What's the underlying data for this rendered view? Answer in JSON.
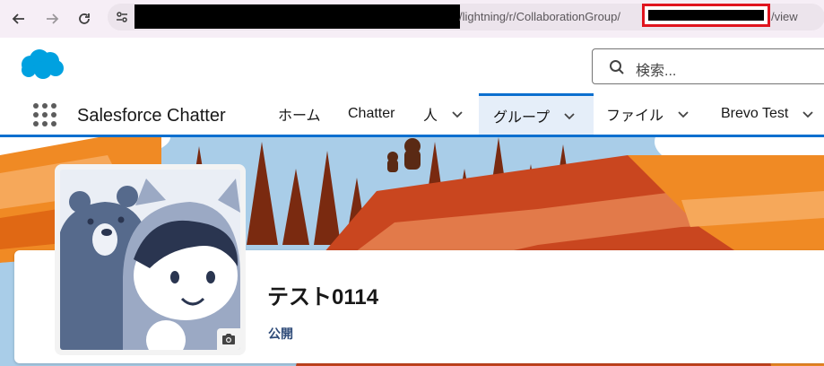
{
  "browser": {
    "url_path": "/lightning/r/CollaborationGroup/",
    "url_tail": "/view"
  },
  "header": {
    "search_placeholder": "検索..."
  },
  "app": {
    "name": "Salesforce Chatter",
    "tabs": [
      {
        "label": "ホーム",
        "has_menu": false,
        "active": false
      },
      {
        "label": "Chatter",
        "has_menu": false,
        "active": false
      },
      {
        "label": "人",
        "has_menu": true,
        "active": false
      },
      {
        "label": "グループ",
        "has_menu": true,
        "active": true
      },
      {
        "label": "ファイル",
        "has_menu": true,
        "active": false
      },
      {
        "label": "Brevo Test",
        "has_menu": true,
        "active": false
      }
    ]
  },
  "group": {
    "title": "テスト0114",
    "access": "公開"
  },
  "colors": {
    "brand_blue": "#0b6fcf",
    "salesforce_cloud": "#00a1e0",
    "redaction_border": "#e0141e"
  }
}
